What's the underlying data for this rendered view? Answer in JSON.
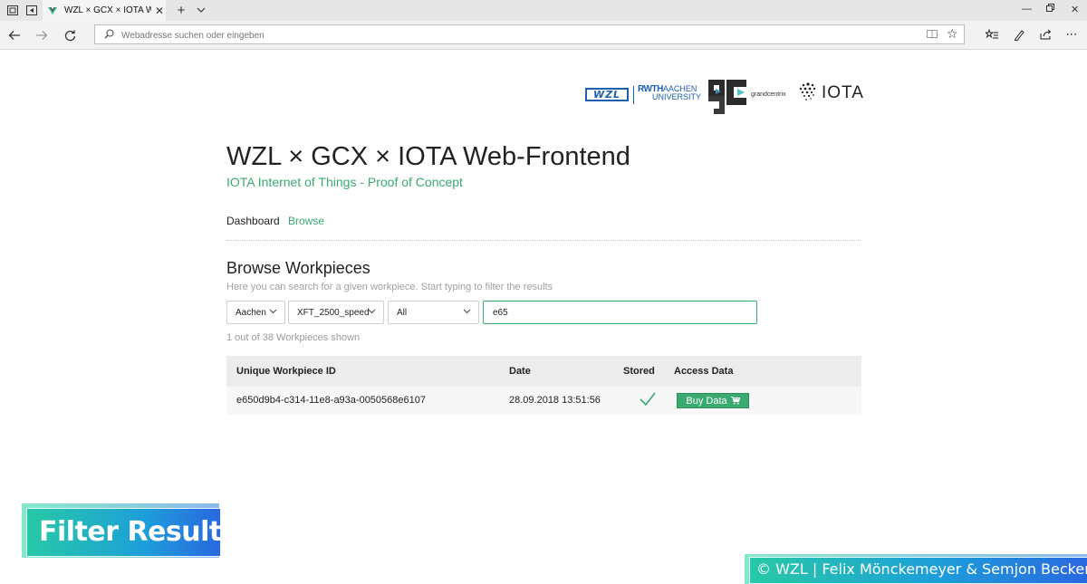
{
  "browser": {
    "tab_title": "WZL × GCX × IOTA Web-Frontend",
    "tab_title_visible": "WZL × GCX × IOTA Wel",
    "address_placeholder": "Webadresse suchen oder eingeben",
    "icons": [
      "tab-preview-icon",
      "set-aside-tabs-icon",
      "vue-favicon",
      "close-tab-icon",
      "new-tab-icon",
      "tab-list-icon",
      "minimize-icon",
      "restore-icon",
      "close-window-icon",
      "back-icon",
      "forward-icon",
      "refresh-icon",
      "search-icon",
      "reading-view-icon",
      "favorite-star-icon",
      "favorites-list-icon",
      "notes-icon",
      "share-icon",
      "more-icon"
    ]
  },
  "logos": {
    "wzl": "WZL",
    "rwth_line1": "RWTH",
    "rwth_line1b": "AACHEN",
    "rwth_line2": "UNIVERSITY",
    "gcx": "grandcentrix",
    "iota": "IOTA"
  },
  "header": {
    "title": "WZL × GCX × IOTA Web-Frontend",
    "subtitle": "IOTA Internet of Things - Proof of Concept"
  },
  "nav": {
    "dashboard": "Dashboard",
    "browse": "Browse",
    "active": "browse"
  },
  "browse": {
    "title": "Browse Workpieces",
    "hint": "Here you can search for a given workpiece. Start typing to filter the results",
    "filters": {
      "city": "Aachen",
      "model": "XFT_2500_speed",
      "status": "All"
    },
    "search_value": "e65",
    "result_count": "1 out of 38 Workpieces shown"
  },
  "table": {
    "columns": [
      "Unique Workpiece ID",
      "Date",
      "Stored",
      "Access Data"
    ],
    "rows": [
      {
        "id": "e650d9b4-c314-11e8-a93a-0050568e6107",
        "date": "28.09.2018 13:51:56",
        "stored": true,
        "action": "Buy Data"
      }
    ]
  },
  "overlays": {
    "caption": "Filter Results",
    "credit": "© WZL | Felix Mönckemeyer & Semjon Becker"
  },
  "colors": {
    "accent": "#3aaa70",
    "overlay_start": "#27c9a6",
    "overlay_end": "#2968e0"
  }
}
